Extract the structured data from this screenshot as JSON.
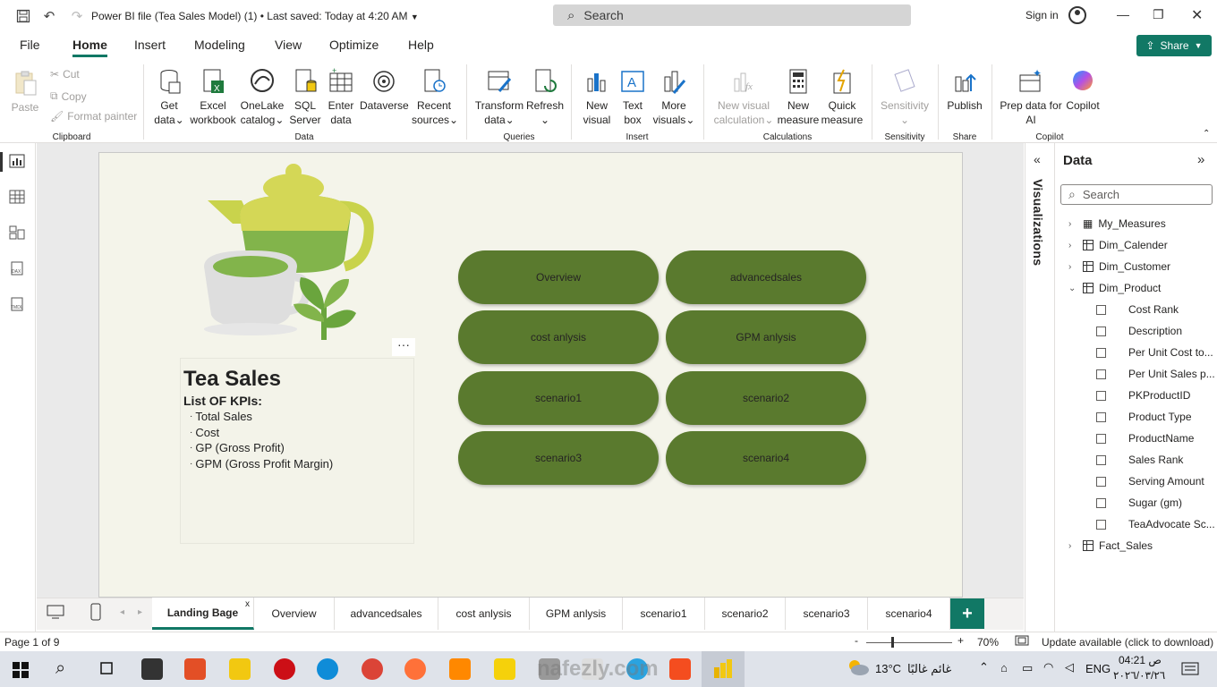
{
  "titlebar": {
    "title": "Power BI file (Tea Sales Model) (1) • Last saved: Today at 4:20 AM",
    "search_placeholder": "Search",
    "sign_in": "Sign in"
  },
  "menu": {
    "tabs": [
      "File",
      "Home",
      "Insert",
      "Modeling",
      "View",
      "Optimize",
      "Help"
    ],
    "active": "Home",
    "share_label": "Share"
  },
  "ribbon": {
    "clipboard": {
      "paste": "Paste",
      "cut": "Cut",
      "copy": "Copy",
      "format_painter": "Format painter",
      "group": "Clipboard"
    },
    "data": {
      "get_data": [
        "Get",
        "data"
      ],
      "excel": [
        "Excel",
        "workbook"
      ],
      "onelake": [
        "OneLake",
        "catalog"
      ],
      "sql": [
        "SQL",
        "Server"
      ],
      "enter": [
        "Enter",
        "data"
      ],
      "dataverse": "Dataverse",
      "recent": [
        "Recent",
        "sources"
      ],
      "group": "Data"
    },
    "queries": {
      "transform": [
        "Transform",
        "data"
      ],
      "refresh": "Refresh",
      "group": "Queries"
    },
    "insert": {
      "new_visual": [
        "New",
        "visual"
      ],
      "text_box": [
        "Text",
        "box"
      ],
      "more_visuals": [
        "More",
        "visuals"
      ],
      "group": "Insert"
    },
    "calculations": {
      "new_visual_calc": [
        "New visual",
        "calculation"
      ],
      "new_measure": [
        "New",
        "measure"
      ],
      "quick_measure": [
        "Quick",
        "measure"
      ],
      "group": "Calculations"
    },
    "sensitivity": {
      "label": "Sensitivity",
      "group": "Sensitivity"
    },
    "share": {
      "publish": "Publish",
      "group": "Share"
    },
    "copilot": {
      "prep": [
        "Prep data for",
        "AI"
      ],
      "copilot": "Copilot",
      "group": "Copilot"
    }
  },
  "report": {
    "title": "Tea Sales",
    "kpi_heading": "List OF KPIs:",
    "kpis": [
      "Total Sales",
      "Cost",
      "GP (Gross Profit)",
      "GPM (Gross Profit Margin)"
    ],
    "more_options": "···",
    "buttons": [
      "Overview",
      "advancedsales",
      "cost anlysis",
      "GPM anlysis",
      "scenario1",
      "scenario2",
      "scenario3",
      "scenario4"
    ]
  },
  "visualizations_pane": {
    "label": "Visualizations"
  },
  "data_pane": {
    "title": "Data",
    "search_placeholder": "Search",
    "tables": [
      {
        "name": "My_Measures",
        "expanded": false
      },
      {
        "name": "Dim_Calender",
        "expanded": false
      },
      {
        "name": "Dim_Customer",
        "expanded": false
      },
      {
        "name": "Dim_Product",
        "expanded": true
      },
      {
        "name": "Fact_Sales",
        "expanded": false
      }
    ],
    "dim_product_fields": [
      "Cost Rank",
      "Description",
      "Per Unit Cost to...",
      "Per Unit Sales p...",
      "PKProductID",
      "Product Type",
      "ProductName",
      "Sales Rank",
      "Serving Amount",
      "Sugar (gm)",
      "TeaAdvocate Sc..."
    ]
  },
  "page_tabs": {
    "tabs": [
      "Landing Bage",
      "Overview",
      "advancedsales",
      "cost anlysis",
      "GPM anlysis",
      "scenario1",
      "scenario2",
      "scenario3",
      "scenario4"
    ],
    "active": "Landing Bage",
    "add": "+"
  },
  "status": {
    "page": "Page 1 of 9",
    "zoom": "70%",
    "update": "Update available (click to download)"
  },
  "taskbar": {
    "weather_temp": "13°C",
    "weather_desc": "غائم غالبًا",
    "lang": "ENG",
    "time": "04:21 ص",
    "date": "٢٠٢٦/٠٣/٢٦",
    "watermark": "nafezly.com"
  },
  "colors": {
    "accent": "#117865",
    "nav_button": "#5a7a2e",
    "page_bg": "#f4f4ea"
  }
}
